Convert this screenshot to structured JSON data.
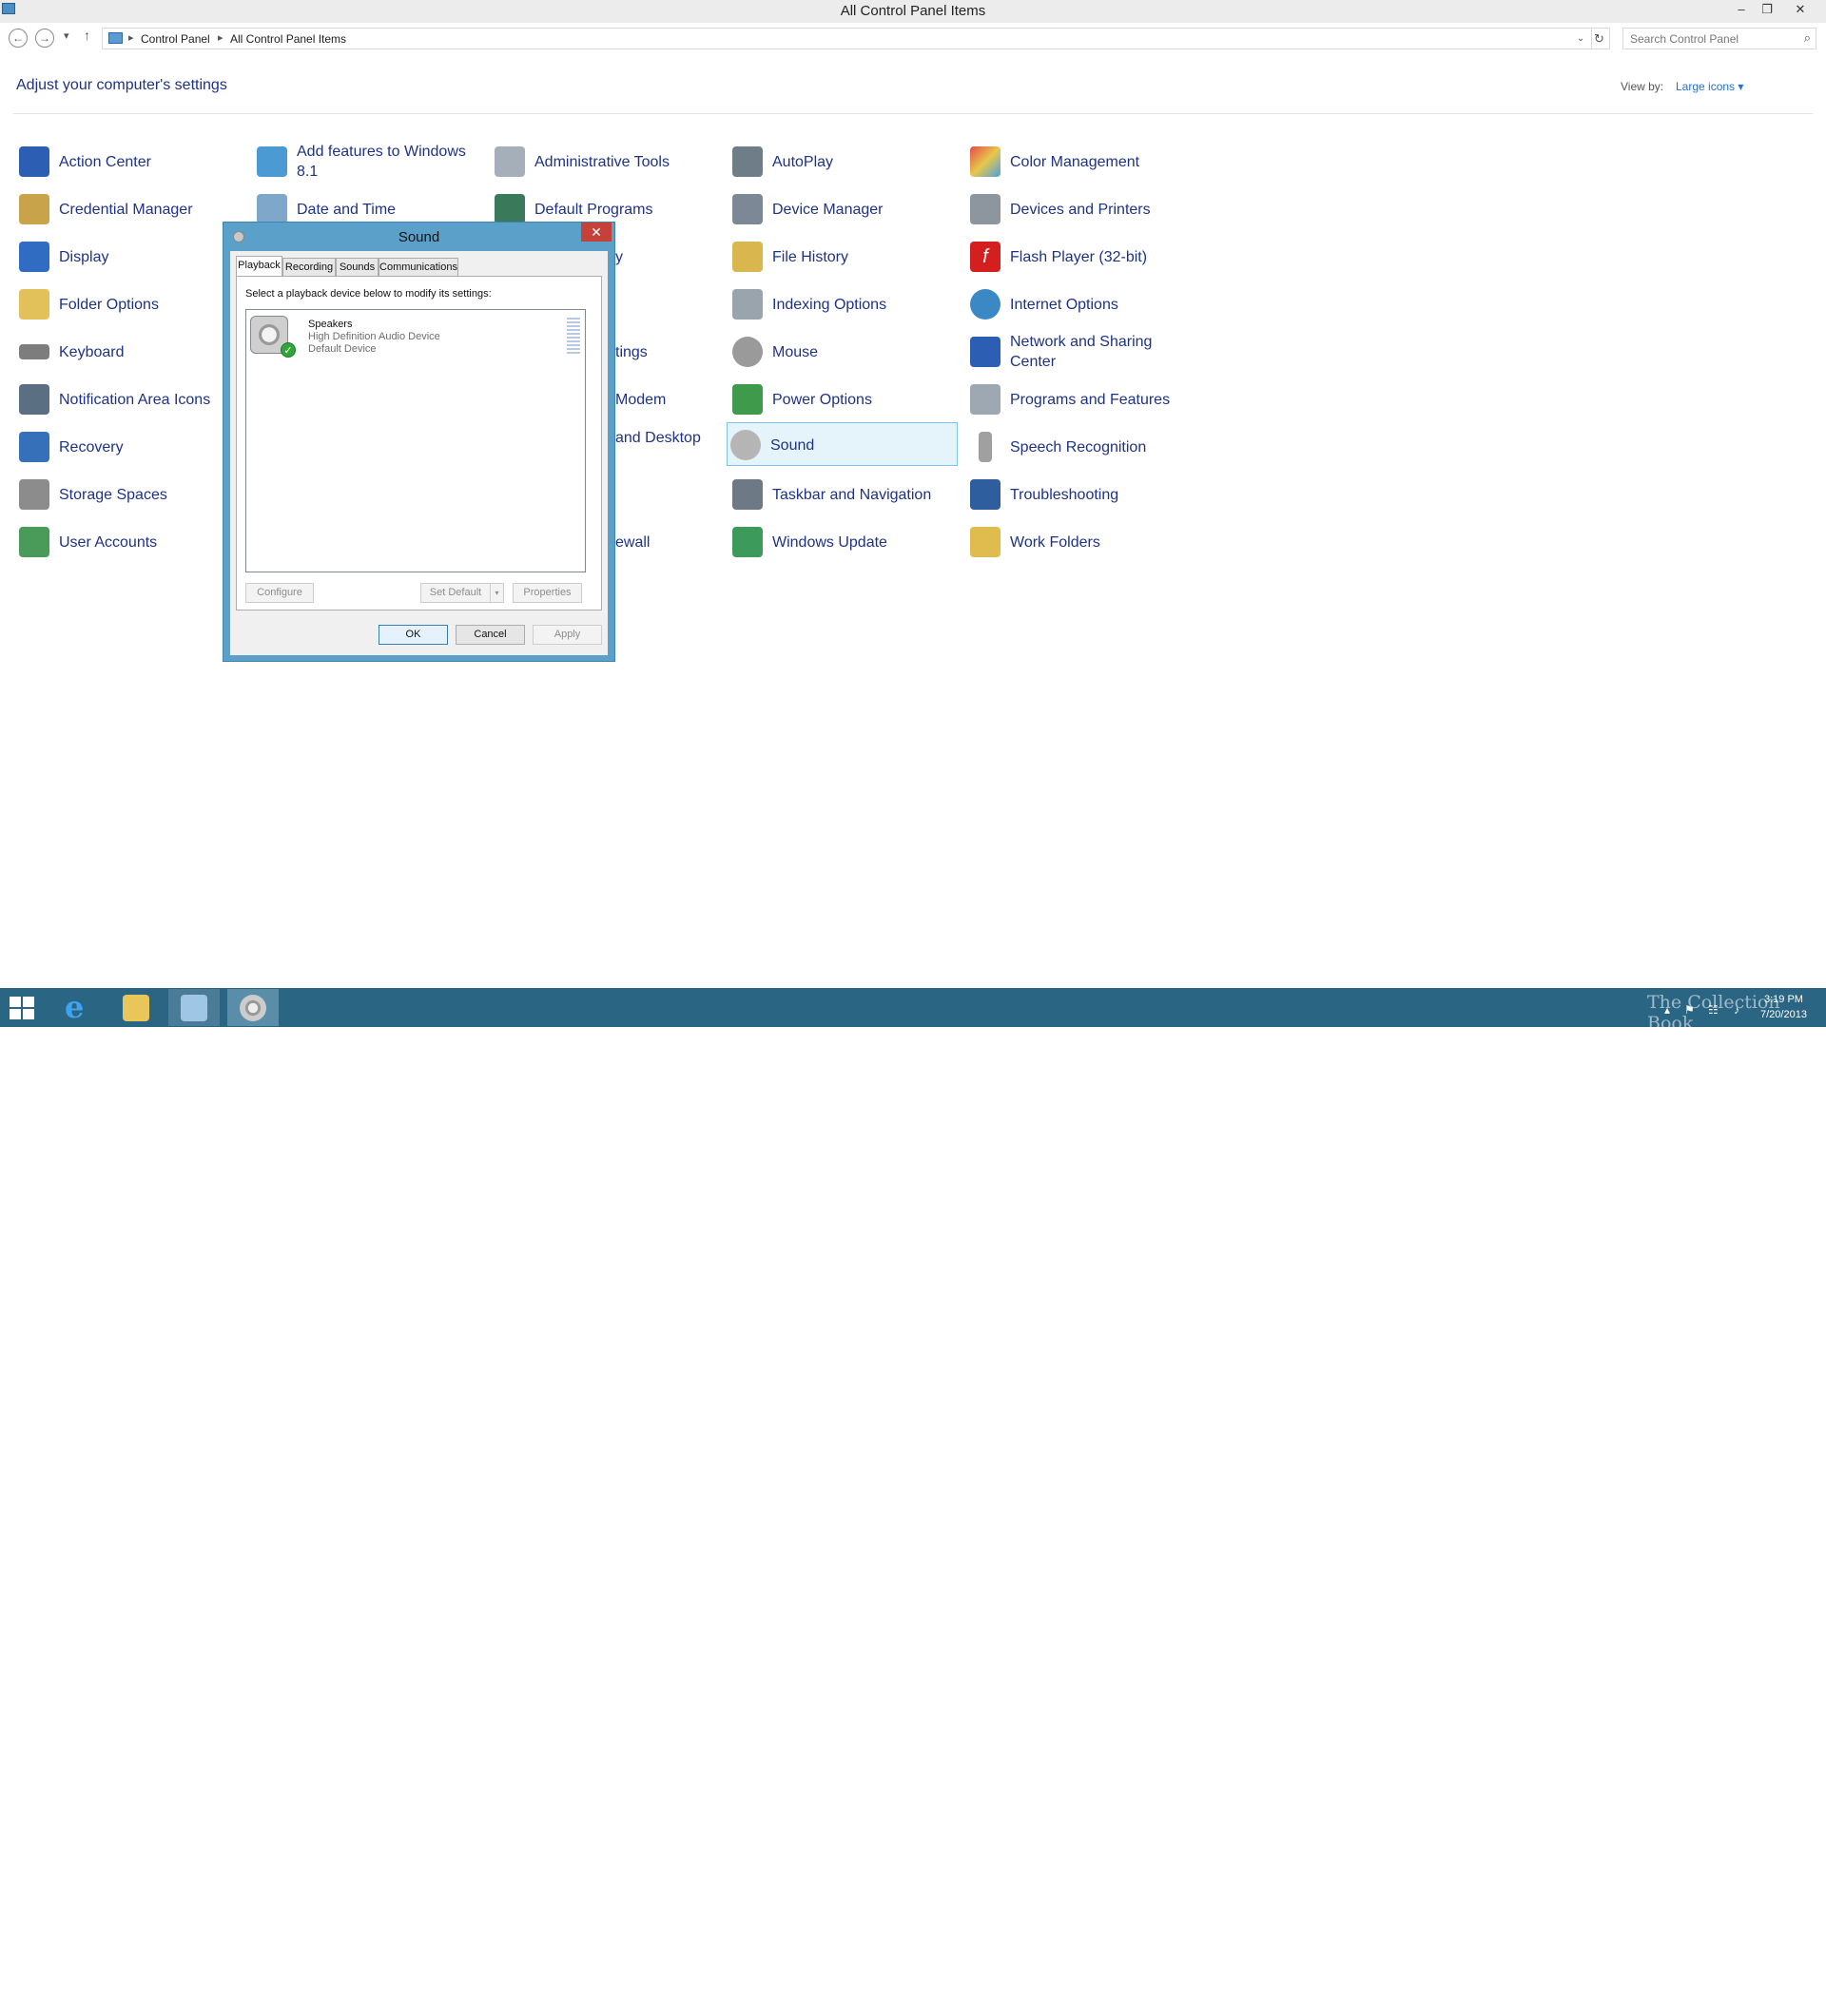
{
  "window": {
    "title": "All Control Panel Items",
    "minimize_glyph": "–",
    "restore_glyph": "❐",
    "close_glyph": "✕"
  },
  "nav": {
    "back_glyph": "←",
    "forward_glyph": "→",
    "recent_glyph": "▾",
    "up_glyph": "↑",
    "breadcrumb": [
      "Control Panel",
      "All Control Panel Items"
    ],
    "separator_glyph": "▸",
    "dropdown_glyph": "⌄",
    "refresh_glyph": "↻",
    "search_placeholder": "Search Control Panel",
    "search_glyph": "⌕"
  },
  "header": {
    "title": "Adjust your computer's settings",
    "view_by_label": "View by:",
    "view_by_value": "Large icons ▾"
  },
  "items": {
    "action_center": "Action Center",
    "add_features": "Add features to Windows 8.1",
    "administrative_tools": "Administrative Tools",
    "autoplay": "AutoPlay",
    "color_management": "Color Management",
    "credential_manager": "Credential Manager",
    "date_and_time": "Date and Time",
    "default_programs": "Default Programs",
    "device_manager": "Device Manager",
    "devices_and_printers": "Devices and Printers",
    "display": "Display",
    "file_history": "File History",
    "flash_player": "Flash Player (32-bit)",
    "folder_options": "Folder Options",
    "indexing_options": "Indexing Options",
    "internet_options": "Internet Options",
    "keyboard": "Keyboard",
    "mouse": "Mouse",
    "network_sharing": "Network and Sharing Center",
    "notification_area_icons": "Notification Area Icons",
    "power_options": "Power Options",
    "programs_and_features": "Programs and Features",
    "recovery": "Recovery",
    "sound": "Sound",
    "speech_recognition": "Speech Recognition",
    "storage_spaces": "Storage Spaces",
    "taskbar_navigation": "Taskbar and Navigation",
    "troubleshooting": "Troubleshooting",
    "user_accounts": "User Accounts",
    "windows_update": "Windows Update",
    "work_folders": "Work Folders",
    "partial_y": "y",
    "partial_settings": "tings",
    "partial_modem": "Modem",
    "partial_desktop": "and Desktop",
    "partial_firewall": "ewall"
  },
  "dialog": {
    "title": "Sound",
    "close_glyph": "✕",
    "tabs": [
      "Playback",
      "Recording",
      "Sounds",
      "Communications"
    ],
    "instruction": "Select a playback device below to modify its settings:",
    "device": {
      "name": "Speakers",
      "description": "High Definition Audio Device",
      "status": "Default Device",
      "check_glyph": "✓"
    },
    "buttons": {
      "configure": "Configure",
      "set_default": "Set Default",
      "set_default_arrow": "▾",
      "properties": "Properties",
      "ok": "OK",
      "cancel": "Cancel",
      "apply": "Apply"
    }
  },
  "taskbar": {
    "ie_glyph": "e",
    "time": "3:19 PM",
    "date": "7/20/2013",
    "tray_up_glyph": "▴",
    "tray_flag_glyph": "⚑",
    "tray_network_glyph": "☷",
    "tray_volume_glyph": "♪",
    "watermark": "The Collection Book"
  },
  "colors": {
    "link_blue": "#1e3287",
    "taskbar": "#2b6584",
    "dialog_frame": "#5aa0c8",
    "close_red": "#c7413b",
    "selection": "#e5f3fb"
  }
}
